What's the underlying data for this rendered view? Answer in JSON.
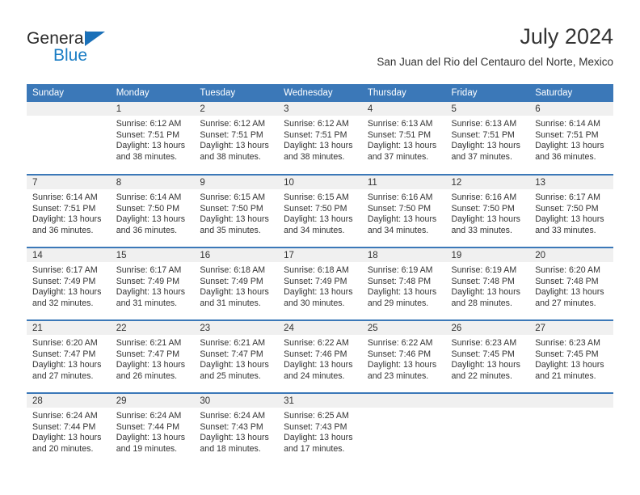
{
  "brand": {
    "name_top": "General",
    "name_bottom": "Blue",
    "triangle_icon": "triangle-icon",
    "colors": {
      "blue": "#1a7dc4",
      "dark": "#2b2b2b"
    }
  },
  "header": {
    "title": "July 2024",
    "subtitle": "San Juan del Rio del Centauro del Norte, Mexico"
  },
  "calendar": {
    "header_bg": "#3b78b8",
    "daynum_bg": "#f0f0f0",
    "weekdays": [
      "Sunday",
      "Monday",
      "Tuesday",
      "Wednesday",
      "Thursday",
      "Friday",
      "Saturday"
    ],
    "weeks": [
      [
        {
          "day": "",
          "sunrise": "",
          "sunset": "",
          "daylight": ""
        },
        {
          "day": "1",
          "sunrise": "Sunrise: 6:12 AM",
          "sunset": "Sunset: 7:51 PM",
          "daylight": "Daylight: 13 hours and 38 minutes."
        },
        {
          "day": "2",
          "sunrise": "Sunrise: 6:12 AM",
          "sunset": "Sunset: 7:51 PM",
          "daylight": "Daylight: 13 hours and 38 minutes."
        },
        {
          "day": "3",
          "sunrise": "Sunrise: 6:12 AM",
          "sunset": "Sunset: 7:51 PM",
          "daylight": "Daylight: 13 hours and 38 minutes."
        },
        {
          "day": "4",
          "sunrise": "Sunrise: 6:13 AM",
          "sunset": "Sunset: 7:51 PM",
          "daylight": "Daylight: 13 hours and 37 minutes."
        },
        {
          "day": "5",
          "sunrise": "Sunrise: 6:13 AM",
          "sunset": "Sunset: 7:51 PM",
          "daylight": "Daylight: 13 hours and 37 minutes."
        },
        {
          "day": "6",
          "sunrise": "Sunrise: 6:14 AM",
          "sunset": "Sunset: 7:51 PM",
          "daylight": "Daylight: 13 hours and 36 minutes."
        }
      ],
      [
        {
          "day": "7",
          "sunrise": "Sunrise: 6:14 AM",
          "sunset": "Sunset: 7:51 PM",
          "daylight": "Daylight: 13 hours and 36 minutes."
        },
        {
          "day": "8",
          "sunrise": "Sunrise: 6:14 AM",
          "sunset": "Sunset: 7:50 PM",
          "daylight": "Daylight: 13 hours and 36 minutes."
        },
        {
          "day": "9",
          "sunrise": "Sunrise: 6:15 AM",
          "sunset": "Sunset: 7:50 PM",
          "daylight": "Daylight: 13 hours and 35 minutes."
        },
        {
          "day": "10",
          "sunrise": "Sunrise: 6:15 AM",
          "sunset": "Sunset: 7:50 PM",
          "daylight": "Daylight: 13 hours and 34 minutes."
        },
        {
          "day": "11",
          "sunrise": "Sunrise: 6:16 AM",
          "sunset": "Sunset: 7:50 PM",
          "daylight": "Daylight: 13 hours and 34 minutes."
        },
        {
          "day": "12",
          "sunrise": "Sunrise: 6:16 AM",
          "sunset": "Sunset: 7:50 PM",
          "daylight": "Daylight: 13 hours and 33 minutes."
        },
        {
          "day": "13",
          "sunrise": "Sunrise: 6:17 AM",
          "sunset": "Sunset: 7:50 PM",
          "daylight": "Daylight: 13 hours and 33 minutes."
        }
      ],
      [
        {
          "day": "14",
          "sunrise": "Sunrise: 6:17 AM",
          "sunset": "Sunset: 7:49 PM",
          "daylight": "Daylight: 13 hours and 32 minutes."
        },
        {
          "day": "15",
          "sunrise": "Sunrise: 6:17 AM",
          "sunset": "Sunset: 7:49 PM",
          "daylight": "Daylight: 13 hours and 31 minutes."
        },
        {
          "day": "16",
          "sunrise": "Sunrise: 6:18 AM",
          "sunset": "Sunset: 7:49 PM",
          "daylight": "Daylight: 13 hours and 31 minutes."
        },
        {
          "day": "17",
          "sunrise": "Sunrise: 6:18 AM",
          "sunset": "Sunset: 7:49 PM",
          "daylight": "Daylight: 13 hours and 30 minutes."
        },
        {
          "day": "18",
          "sunrise": "Sunrise: 6:19 AM",
          "sunset": "Sunset: 7:48 PM",
          "daylight": "Daylight: 13 hours and 29 minutes."
        },
        {
          "day": "19",
          "sunrise": "Sunrise: 6:19 AM",
          "sunset": "Sunset: 7:48 PM",
          "daylight": "Daylight: 13 hours and 28 minutes."
        },
        {
          "day": "20",
          "sunrise": "Sunrise: 6:20 AM",
          "sunset": "Sunset: 7:48 PM",
          "daylight": "Daylight: 13 hours and 27 minutes."
        }
      ],
      [
        {
          "day": "21",
          "sunrise": "Sunrise: 6:20 AM",
          "sunset": "Sunset: 7:47 PM",
          "daylight": "Daylight: 13 hours and 27 minutes."
        },
        {
          "day": "22",
          "sunrise": "Sunrise: 6:21 AM",
          "sunset": "Sunset: 7:47 PM",
          "daylight": "Daylight: 13 hours and 26 minutes."
        },
        {
          "day": "23",
          "sunrise": "Sunrise: 6:21 AM",
          "sunset": "Sunset: 7:47 PM",
          "daylight": "Daylight: 13 hours and 25 minutes."
        },
        {
          "day": "24",
          "sunrise": "Sunrise: 6:22 AM",
          "sunset": "Sunset: 7:46 PM",
          "daylight": "Daylight: 13 hours and 24 minutes."
        },
        {
          "day": "25",
          "sunrise": "Sunrise: 6:22 AM",
          "sunset": "Sunset: 7:46 PM",
          "daylight": "Daylight: 13 hours and 23 minutes."
        },
        {
          "day": "26",
          "sunrise": "Sunrise: 6:23 AM",
          "sunset": "Sunset: 7:45 PM",
          "daylight": "Daylight: 13 hours and 22 minutes."
        },
        {
          "day": "27",
          "sunrise": "Sunrise: 6:23 AM",
          "sunset": "Sunset: 7:45 PM",
          "daylight": "Daylight: 13 hours and 21 minutes."
        }
      ],
      [
        {
          "day": "28",
          "sunrise": "Sunrise: 6:24 AM",
          "sunset": "Sunset: 7:44 PM",
          "daylight": "Daylight: 13 hours and 20 minutes."
        },
        {
          "day": "29",
          "sunrise": "Sunrise: 6:24 AM",
          "sunset": "Sunset: 7:44 PM",
          "daylight": "Daylight: 13 hours and 19 minutes."
        },
        {
          "day": "30",
          "sunrise": "Sunrise: 6:24 AM",
          "sunset": "Sunset: 7:43 PM",
          "daylight": "Daylight: 13 hours and 18 minutes."
        },
        {
          "day": "31",
          "sunrise": "Sunrise: 6:25 AM",
          "sunset": "Sunset: 7:43 PM",
          "daylight": "Daylight: 13 hours and 17 minutes."
        },
        {
          "day": "",
          "sunrise": "",
          "sunset": "",
          "daylight": ""
        },
        {
          "day": "",
          "sunrise": "",
          "sunset": "",
          "daylight": ""
        },
        {
          "day": "",
          "sunrise": "",
          "sunset": "",
          "daylight": ""
        }
      ]
    ]
  }
}
